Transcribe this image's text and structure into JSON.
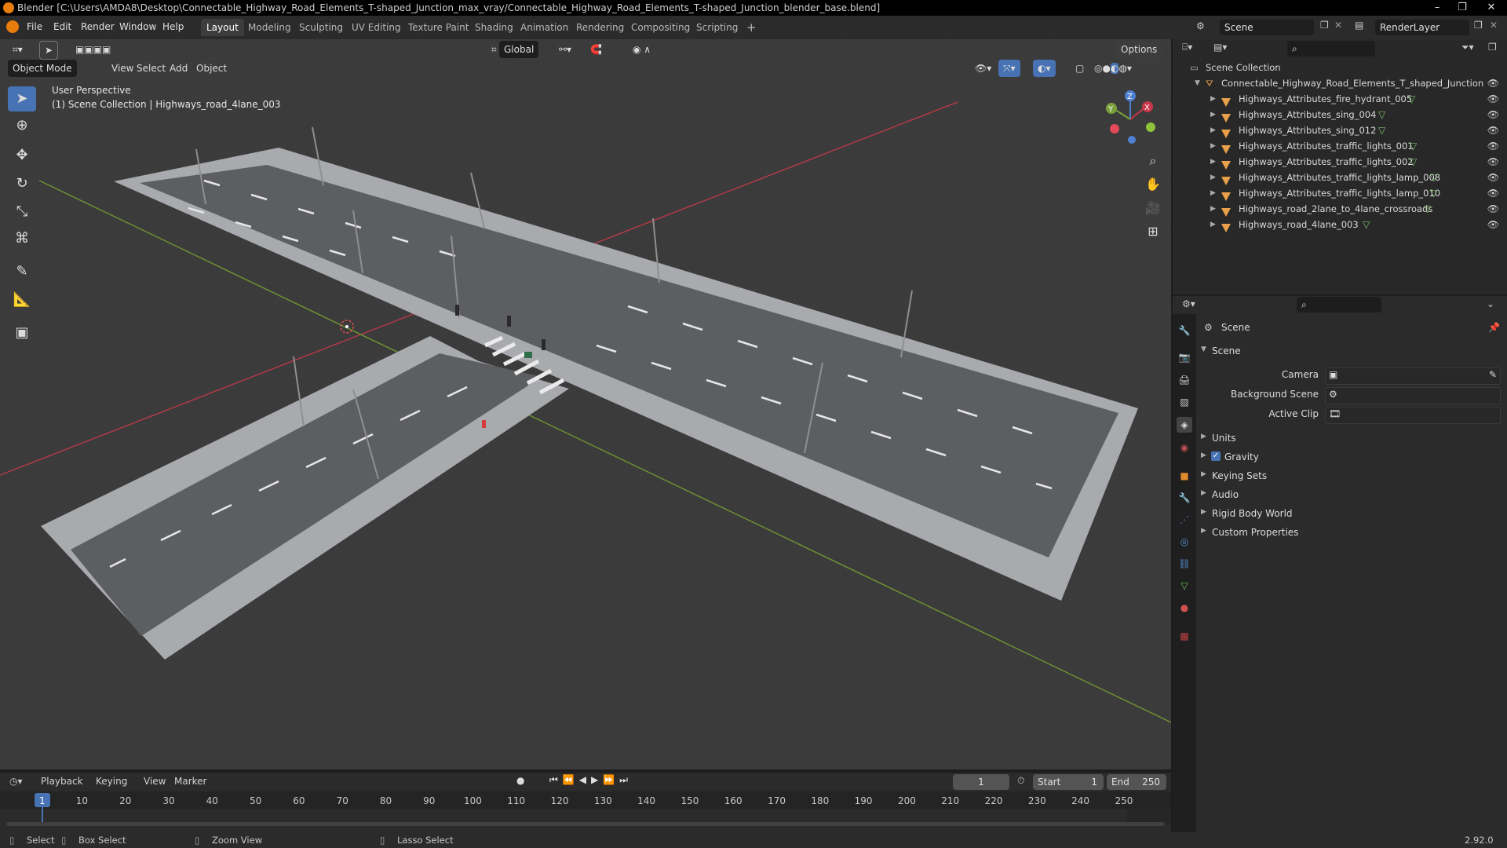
{
  "window": {
    "title": "Blender [C:\\Users\\AMDA8\\Desktop\\Connectable_Highway_Road_Elements_T-shaped_Junction_max_vray/Connectable_Highway_Road_Elements_T-shaped_Junction_blender_base.blend]"
  },
  "menu": [
    "File",
    "Edit",
    "Render",
    "Window",
    "Help"
  ],
  "workspaces": [
    "Layout",
    "Modeling",
    "Sculpting",
    "UV Editing",
    "Texture Paint",
    "Shading",
    "Animation",
    "Rendering",
    "Compositing",
    "Scripting"
  ],
  "active_workspace": "Layout",
  "scene_field": "Scene",
  "renderlayer_field": "RenderLayer",
  "viewport": {
    "mode": "Object Mode",
    "header_menus": [
      "View",
      "Select",
      "Add",
      "Object"
    ],
    "transform_orientation": "Global",
    "options": "Options",
    "overlay_line1": "User Perspective",
    "overlay_line2": "(1) Scene Collection | Highways_road_4lane_003",
    "gizmo": {
      "x": "X",
      "y": "Y",
      "z": "Z"
    }
  },
  "outliner": {
    "root": "Scene Collection",
    "collection": "Connectable_Highway_Road_Elements_T_shaped_Junction",
    "items": [
      "Highways_Attributes_fire_hydrant_005",
      "Highways_Attributes_sing_004",
      "Highways_Attributes_sing_012",
      "Highways_Attributes_traffic_lights_001",
      "Highways_Attributes_traffic_lights_002",
      "Highways_Attributes_traffic_lights_lamp_008",
      "Highways_Attributes_traffic_lights_lamp_010",
      "Highways_road_2lane_to_4lane_crossroads",
      "Highways_road_4lane_003"
    ]
  },
  "properties": {
    "context": "Scene",
    "panel": "Scene",
    "fields": [
      {
        "label": "Camera"
      },
      {
        "label": "Background Scene"
      },
      {
        "label": "Active Clip"
      }
    ],
    "subpanels": [
      "Units",
      "Gravity",
      "Keying Sets",
      "Audio",
      "Rigid Body World",
      "Custom Properties"
    ]
  },
  "timeline": {
    "menus": [
      "Playback",
      "Keying",
      "View",
      "Marker"
    ],
    "current_frame": "1",
    "start_label": "Start",
    "start": "1",
    "end_label": "End",
    "end": "250",
    "ticks": [
      "1",
      "10",
      "20",
      "30",
      "40",
      "50",
      "60",
      "70",
      "80",
      "90",
      "100",
      "110",
      "120",
      "130",
      "140",
      "150",
      "160",
      "170",
      "180",
      "190",
      "200",
      "210",
      "220",
      "230",
      "240",
      "250"
    ]
  },
  "status": {
    "select": "Select",
    "box_select": "Box Select",
    "zoom_view": "Zoom View",
    "lasso_select": "Lasso Select",
    "version": "2.92.0"
  },
  "colors": {
    "accent": "#4772b3",
    "x_axis": "#c9374a",
    "y_axis": "#7ba03a",
    "road": "#5a5c60",
    "sidewalk": "#a7a9ad"
  }
}
